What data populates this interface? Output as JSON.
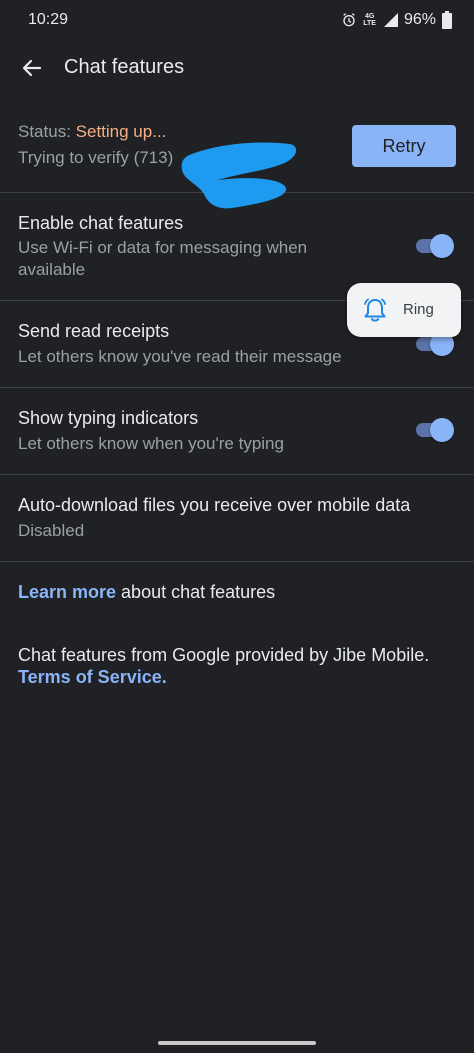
{
  "status_bar": {
    "time": "10:29",
    "network_top": "4G",
    "network_bottom": "LTE",
    "battery": "96%"
  },
  "app_bar": {
    "title": "Chat features",
    "back_icon": "arrow-back-icon"
  },
  "status_section": {
    "label": "Status:",
    "value": "Setting up...",
    "detail": "Trying to verify (713)",
    "retry_label": "Retry",
    "colors": {
      "value": "#f6ae84",
      "redaction": "#1e9bf0"
    }
  },
  "settings": [
    {
      "title": "Enable chat features",
      "summary": "Use Wi-Fi or data for messaging when available",
      "toggle": "on"
    },
    {
      "title": "Send read receipts",
      "summary": "Let others know you've read their message",
      "toggle": "on"
    },
    {
      "title": "Show typing indicators",
      "summary": "Let others know when you're typing",
      "toggle": "on"
    },
    {
      "title": "Auto-download files you receive over mobile data",
      "summary": "Disabled"
    }
  ],
  "ring_popup": {
    "label": "Ring",
    "icon": "bell-icon"
  },
  "learn_more": {
    "link": "Learn more",
    "rest": " about chat features"
  },
  "legal": {
    "text": "Chat features from Google provided by Jibe Mobile.",
    "link": "Terms of Service."
  },
  "colors": {
    "accent": "#8ab4f8",
    "background": "#202124",
    "divider": "#3c4043"
  }
}
